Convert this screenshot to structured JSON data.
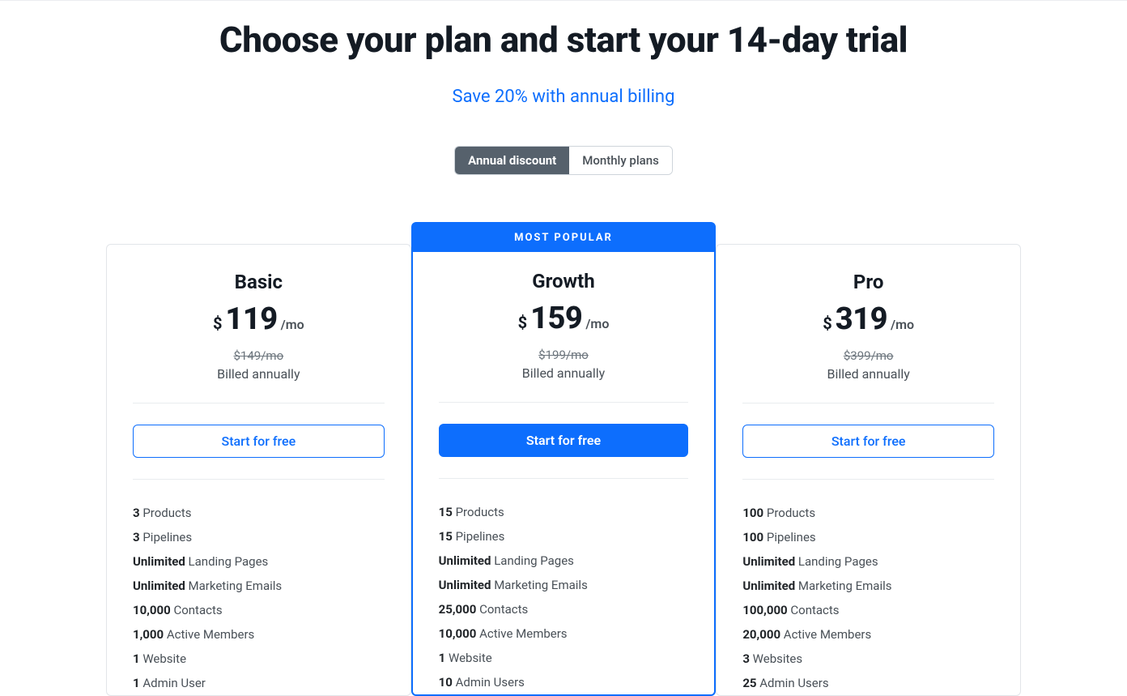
{
  "headline": "Choose your plan and start your 14-day trial",
  "subhead": "Save 20% with annual billing",
  "toggle": {
    "annual": "Annual discount",
    "monthly": "Monthly plans"
  },
  "badge": "MOST POPULAR",
  "currency": "$",
  "per": "/mo",
  "cta": "Start for free",
  "billed_label": "Billed annually",
  "plans": [
    {
      "name": "Basic",
      "price": "119",
      "strike": "$149/mo",
      "features": [
        {
          "bold": "3",
          "text": " Products"
        },
        {
          "bold": "3",
          "text": " Pipelines"
        },
        {
          "bold": "Unlimited",
          "text": " Landing Pages"
        },
        {
          "bold": "Unlimited",
          "text": " Marketing Emails"
        },
        {
          "bold": "10,000",
          "text": " Contacts"
        },
        {
          "bold": "1,000",
          "text": " Active Members"
        },
        {
          "bold": "1",
          "text": " Website"
        },
        {
          "bold": "1",
          "text": " Admin User"
        }
      ]
    },
    {
      "name": "Growth",
      "price": "159",
      "strike": "$199/mo",
      "features": [
        {
          "bold": "15",
          "text": " Products"
        },
        {
          "bold": "15",
          "text": " Pipelines"
        },
        {
          "bold": "Unlimited",
          "text": " Landing Pages"
        },
        {
          "bold": "Unlimited",
          "text": " Marketing Emails"
        },
        {
          "bold": "25,000",
          "text": " Contacts"
        },
        {
          "bold": "10,000",
          "text": " Active Members"
        },
        {
          "bold": "1",
          "text": " Website"
        },
        {
          "bold": "10",
          "text": " Admin Users"
        }
      ]
    },
    {
      "name": "Pro",
      "price": "319",
      "strike": "$399/mo",
      "features": [
        {
          "bold": "100",
          "text": " Products"
        },
        {
          "bold": "100",
          "text": " Pipelines"
        },
        {
          "bold": "Unlimited",
          "text": " Landing Pages"
        },
        {
          "bold": "Unlimited",
          "text": " Marketing Emails"
        },
        {
          "bold": "100,000",
          "text": " Contacts"
        },
        {
          "bold": "20,000",
          "text": " Active Members"
        },
        {
          "bold": "3",
          "text": " Websites"
        },
        {
          "bold": "25",
          "text": " Admin Users"
        }
      ]
    }
  ]
}
